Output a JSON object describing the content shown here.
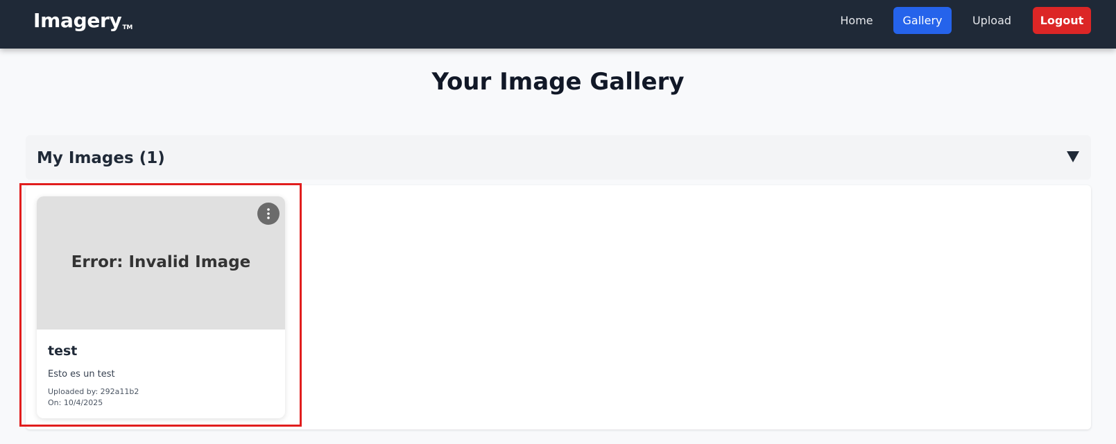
{
  "app": {
    "brand": "Imagery",
    "brand_mark": "TM"
  },
  "nav": {
    "home": "Home",
    "gallery": "Gallery",
    "upload": "Upload",
    "logout": "Logout",
    "active": "Gallery"
  },
  "page": {
    "title": "Your Image Gallery"
  },
  "section": {
    "title": "My Images (1)",
    "toggle_icon": "triangle-down-icon"
  },
  "cards": [
    {
      "image_status": "Error: Invalid Image",
      "title": "test",
      "description": "Esto es un test",
      "uploaded_by": "Uploaded by: 292a11b2",
      "date": "On: 10/4/2025",
      "menu_icon": "kebab-menu-icon"
    }
  ],
  "colors": {
    "navbar_bg": "#1f2937",
    "active_nav": "#2563eb",
    "logout": "#dc2626",
    "highlight": "#e11d1d"
  }
}
